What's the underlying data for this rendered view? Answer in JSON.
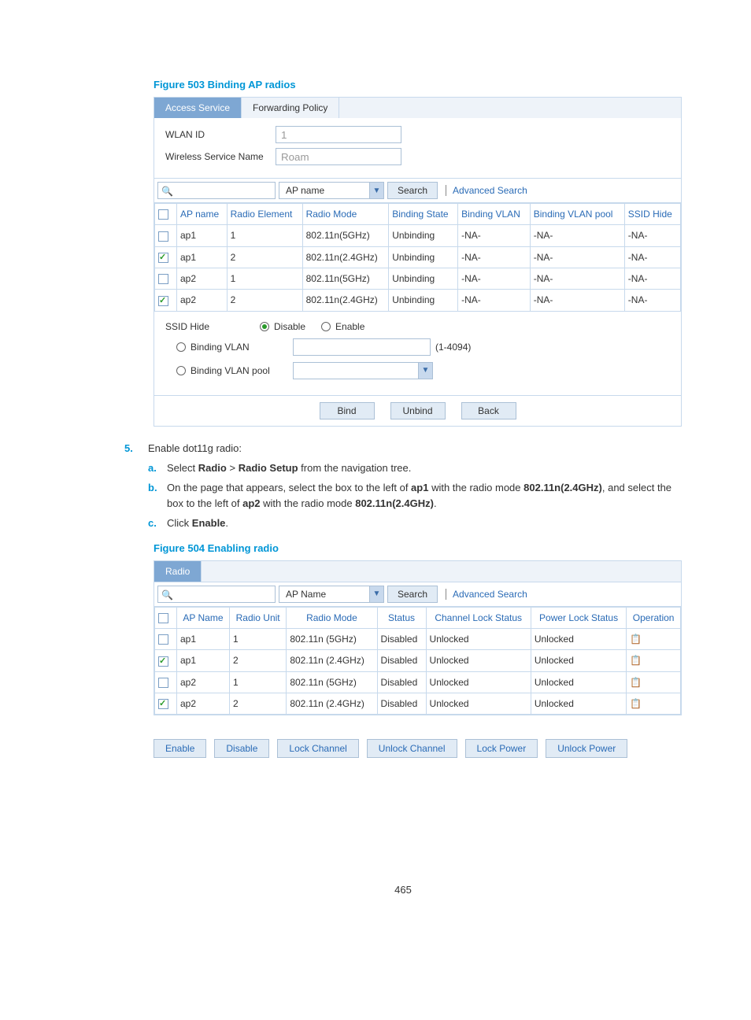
{
  "figure503": {
    "title": "Figure 503 Binding AP radios",
    "tabs": {
      "access": "Access Service",
      "forwarding": "Forwarding Policy"
    },
    "form": {
      "wlan_id_label": "WLAN ID",
      "wlan_id_value": "1",
      "service_name_label": "Wireless Service Name",
      "service_name_value": "Roam"
    },
    "search": {
      "dropdown": "AP name",
      "button": "Search",
      "advanced": "Advanced Search"
    },
    "table": {
      "headers": [
        "AP name",
        "Radio Element",
        "Radio Mode",
        "Binding State",
        "Binding VLAN",
        "Binding VLAN pool",
        "SSID Hide"
      ],
      "rows": [
        {
          "checked": false,
          "cells": [
            "ap1",
            "1",
            "802.11n(5GHz)",
            "Unbinding",
            "-NA-",
            "-NA-",
            "-NA-"
          ]
        },
        {
          "checked": true,
          "cells": [
            "ap1",
            "2",
            "802.11n(2.4GHz)",
            "Unbinding",
            "-NA-",
            "-NA-",
            "-NA-"
          ]
        },
        {
          "checked": false,
          "cells": [
            "ap2",
            "1",
            "802.11n(5GHz)",
            "Unbinding",
            "-NA-",
            "-NA-",
            "-NA-"
          ]
        },
        {
          "checked": true,
          "cells": [
            "ap2",
            "2",
            "802.11n(2.4GHz)",
            "Unbinding",
            "-NA-",
            "-NA-",
            "-NA-"
          ]
        }
      ]
    },
    "settings": {
      "ssid_hide_label": "SSID Hide",
      "disable": "Disable",
      "enable": "Enable",
      "binding_vlan": "Binding VLAN",
      "vlan_range": "(1-4094)",
      "binding_vlan_pool": "Binding VLAN pool"
    },
    "actions": {
      "bind": "Bind",
      "unbind": "Unbind",
      "back": "Back"
    }
  },
  "step5": {
    "num": "5.",
    "text": "Enable dot11g radio:",
    "sub_a": {
      "letter": "a.",
      "prefix": "Select ",
      "bold1": "Radio",
      "mid": " > ",
      "bold2": "Radio Setup",
      "suffix": " from the navigation tree."
    },
    "sub_b": {
      "letter": "b.",
      "p1": "On the page that appears, select the box to the left of ",
      "b1": "ap1",
      "p2": " with the radio mode ",
      "b2": "802.11n(2.4GHz)",
      "p3": ", and select the box to the left of ",
      "b3": "ap2",
      "p4": " with the radio mode ",
      "b4": "802.11n(2.4GHz)",
      "p5": "."
    },
    "sub_c": {
      "letter": "c.",
      "prefix": "Click ",
      "bold": "Enable",
      "suffix": "."
    }
  },
  "figure504": {
    "title": "Figure 504 Enabling radio",
    "tab": "Radio",
    "search": {
      "dropdown": "AP Name",
      "button": "Search",
      "advanced": "Advanced Search"
    },
    "table": {
      "headers": [
        "AP Name",
        "Radio Unit",
        "Radio Mode",
        "Status",
        "Channel Lock Status",
        "Power Lock Status",
        "Operation"
      ],
      "rows": [
        {
          "checked": false,
          "cells": [
            "ap1",
            "1",
            "802.11n (5GHz)",
            "Disabled",
            "Unlocked",
            "Unlocked"
          ]
        },
        {
          "checked": true,
          "cells": [
            "ap1",
            "2",
            "802.11n (2.4GHz)",
            "Disabled",
            "Unlocked",
            "Unlocked"
          ]
        },
        {
          "checked": false,
          "cells": [
            "ap2",
            "1",
            "802.11n (5GHz)",
            "Disabled",
            "Unlocked",
            "Unlocked"
          ]
        },
        {
          "checked": true,
          "cells": [
            "ap2",
            "2",
            "802.11n (2.4GHz)",
            "Disabled",
            "Unlocked",
            "Unlocked"
          ]
        }
      ]
    },
    "buttons": [
      "Enable",
      "Disable",
      "Lock Channel",
      "Unlock Channel",
      "Lock Power",
      "Unlock Power"
    ]
  },
  "page_number": "465"
}
